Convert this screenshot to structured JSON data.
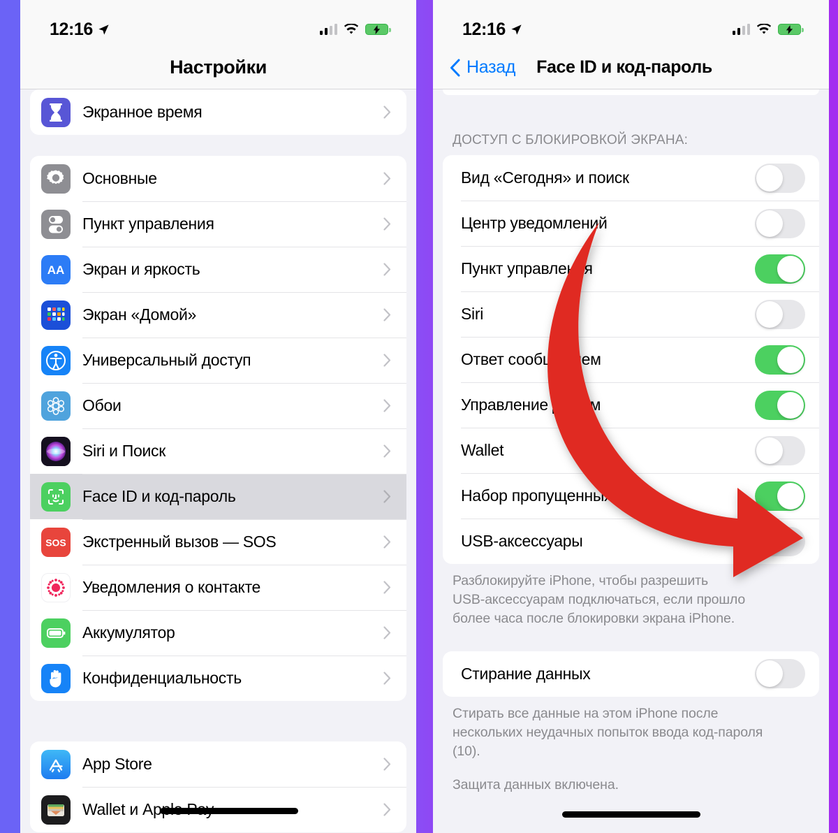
{
  "background": {
    "from": "#6B63F6",
    "to": "#A32CF0"
  },
  "status_bar": {
    "time": "12:16",
    "location_icon": "location-arrow-icon",
    "signal_icon": "cellular-signal-icon",
    "wifi_icon": "wifi-icon",
    "battery_icon": "battery-charging-icon",
    "battery_charging": true,
    "signal_bars_filled": 2,
    "signal_bars_total": 4
  },
  "left_phone": {
    "nav": {
      "title": "Настройки"
    },
    "groups": [
      {
        "id": "screen-time",
        "cut_top": false,
        "rows": [
          {
            "label": "Экранное время",
            "icon": "screen-time-icon",
            "icon_bg": "#5856D6",
            "selected": false
          }
        ]
      },
      {
        "id": "system",
        "rows": [
          {
            "label": "Основные",
            "icon": "gear-icon",
            "icon_bg": "#8E8E93",
            "selected": false
          },
          {
            "label": "Пункт управления",
            "icon": "control-center-icon",
            "icon_bg": "#8E8E93",
            "selected": false
          },
          {
            "label": "Экран и яркость",
            "icon": "display-brightness-icon",
            "icon_bg": "#2C7CF6",
            "selected": false
          },
          {
            "label": "Экран «Домой»",
            "icon": "home-screen-icon",
            "icon_bg": "#1B4FD8",
            "selected": false
          },
          {
            "label": "Универсальный доступ",
            "icon": "accessibility-icon",
            "icon_bg": "#1683F7",
            "selected": false
          },
          {
            "label": "Обои",
            "icon": "wallpaper-icon",
            "icon_bg": "#4FA3DD",
            "selected": false
          },
          {
            "label": "Siri и Поиск",
            "icon": "siri-icon",
            "icon_bg": "#1A1A2E",
            "selected": false
          },
          {
            "label": "Face ID и код-пароль",
            "icon": "face-id-icon",
            "icon_bg": "#4CD060",
            "selected": true
          },
          {
            "label": "Экстренный вызов — SOS",
            "icon": "sos-icon",
            "icon_bg": "#E8453C",
            "selected": false
          },
          {
            "label": "Уведомления о контакте",
            "icon": "contact-notification-icon",
            "icon_bg": "#FFFFFF",
            "selected": false
          },
          {
            "label": "Аккумулятор",
            "icon": "battery-icon",
            "icon_bg": "#4CD060",
            "selected": false
          },
          {
            "label": "Конфиденциальность",
            "icon": "privacy-hand-icon",
            "icon_bg": "#1683F7",
            "selected": false
          }
        ]
      },
      {
        "id": "store",
        "rows": [
          {
            "label": "App Store",
            "icon": "app-store-icon",
            "icon_bg": "#2C9DF6",
            "selected": false
          },
          {
            "label": "Wallet и Apple Pay",
            "icon": "wallet-icon",
            "icon_bg": "#1C1C1E",
            "selected": false
          }
        ]
      }
    ]
  },
  "right_phone": {
    "nav": {
      "back_label": "Назад",
      "title": "Face ID и код-пароль"
    },
    "section_header": "ДОСТУП С БЛОКИРОВКОЙ ЭКРАНА:",
    "toggles": [
      {
        "label": "Вид «Сегодня» и поиск",
        "on": false
      },
      {
        "label": "Центр уведомлений",
        "on": false
      },
      {
        "label": "Пункт управления",
        "on": true
      },
      {
        "label": "Siri",
        "on": false
      },
      {
        "label": "Ответ сообщением",
        "on": true
      },
      {
        "label": "Управление домом",
        "on": true
      },
      {
        "label": "Wallet",
        "on": false
      },
      {
        "label": "Набор пропущенных",
        "on": true
      },
      {
        "label": "USB-аксессуары",
        "on": false
      }
    ],
    "usb_footnote": "Разблокируйте iPhone, чтобы разрешить\nUSB-аксессуарам подключаться, если прошло\nболее часа после блокировки экрана iPhone.",
    "erase_toggle": {
      "label": "Стирание данных",
      "on": false
    },
    "erase_footnote": "Стирать все данные на этом iPhone после\nнескольких неудачных попыток ввода код-пароля\n(10).",
    "protection_footnote": "Защита данных включена.",
    "annotation": {
      "type": "curved-arrow",
      "color": "#E02B20",
      "points_to": "USB-аксессуары"
    }
  },
  "colors": {
    "toggle_on": "#4CD060",
    "toggle_off": "#E7E7EA",
    "accent_blue": "#007AFF",
    "page_bg": "#F2F2F7",
    "card_bg": "#FFFFFF",
    "arrow_red": "#E02B20"
  }
}
